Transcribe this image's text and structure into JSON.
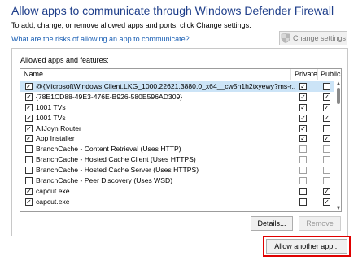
{
  "header": {
    "title": "Allow apps to communicate through Windows Defender Firewall",
    "subtitle": "To add, change, or remove allowed apps and ports, click Change settings.",
    "risk_link": "What are the risks of allowing an app to communicate?",
    "change_settings_label": "Change settings"
  },
  "group": {
    "label": "Allowed apps and features:",
    "columns": {
      "name": "Name",
      "private": "Private",
      "public": "Public"
    }
  },
  "apps": [
    {
      "name": "@{MicrosoftWindows.Client.LKG_1000.22621.3880.0_x64__cw5n1h2txyewy?ms-r...",
      "enabled": true,
      "private": true,
      "public": false,
      "selected": true
    },
    {
      "name": "{78E1CD88-49E3-476E-B926-580E596AD309}",
      "enabled": true,
      "private": true,
      "public": true
    },
    {
      "name": "1001 TVs",
      "enabled": true,
      "private": true,
      "public": true
    },
    {
      "name": "1001 TVs",
      "enabled": true,
      "private": true,
      "public": true
    },
    {
      "name": "AllJoyn Router",
      "enabled": true,
      "private": true,
      "public": false
    },
    {
      "name": "App Installer",
      "enabled": true,
      "private": true,
      "public": true
    },
    {
      "name": "BranchCache - Content Retrieval (Uses HTTP)",
      "enabled": false,
      "private": false,
      "public": false
    },
    {
      "name": "BranchCache - Hosted Cache Client (Uses HTTPS)",
      "enabled": false,
      "private": false,
      "public": false
    },
    {
      "name": "BranchCache - Hosted Cache Server (Uses HTTPS)",
      "enabled": false,
      "private": false,
      "public": false
    },
    {
      "name": "BranchCache - Peer Discovery (Uses WSD)",
      "enabled": false,
      "private": false,
      "public": false
    },
    {
      "name": "capcut.exe",
      "enabled": true,
      "private": false,
      "public": true
    },
    {
      "name": "capcut.exe",
      "enabled": true,
      "private": false,
      "public": true
    }
  ],
  "buttons": {
    "details": "Details...",
    "remove": "Remove",
    "allow_another": "Allow another app..."
  },
  "colors": {
    "title": "#1e3e8a",
    "link": "#1a5fb4",
    "selection": "#cce4f7",
    "highlight": "#e00000"
  }
}
